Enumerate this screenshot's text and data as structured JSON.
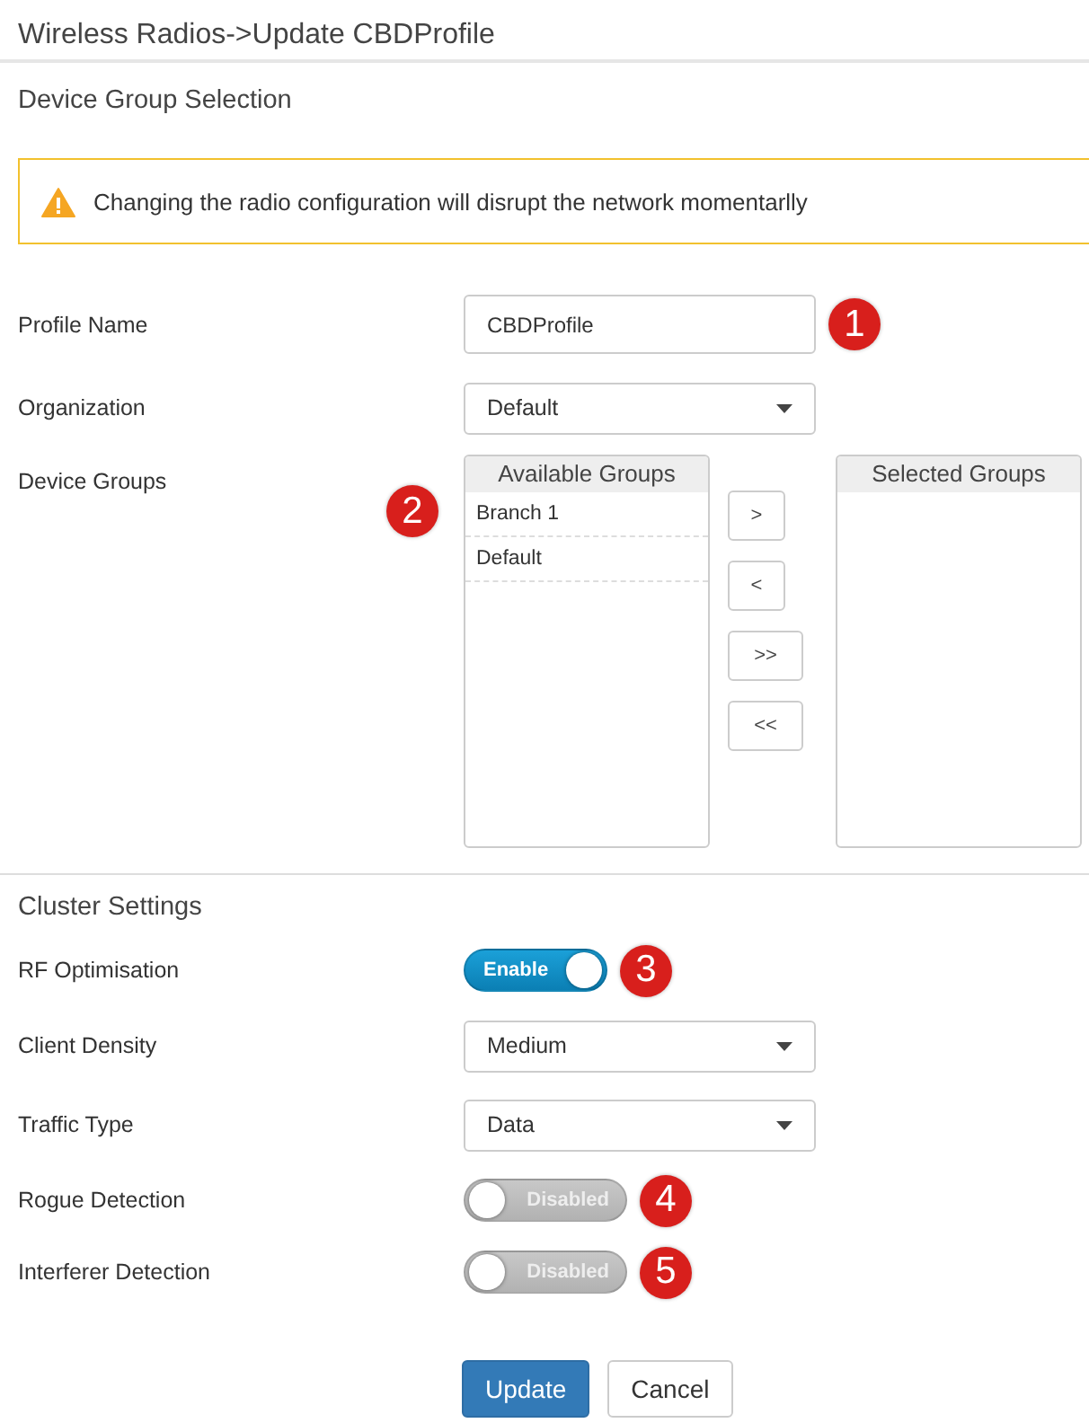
{
  "page_title": "Wireless Radios->Update CBDProfile",
  "sections": [
    {
      "title": "Device Group Selection",
      "warning": "Changing the radio configuration will disrupt the network momentarlly",
      "fields": [
        {
          "kind": "input",
          "label": "Profile Name",
          "value": "CBDProfile",
          "callout": "1"
        },
        {
          "kind": "select",
          "label": "Organization",
          "value": "Default"
        },
        {
          "kind": "duallist",
          "label": "Device Groups",
          "callout": "2",
          "available": {
            "title": "Available Groups",
            "items": [
              "Branch 1",
              "Default"
            ]
          },
          "selected": {
            "title": "Selected Groups"
          },
          "move_buttons": [
            ">",
            "<",
            ">>",
            "<<"
          ]
        }
      ]
    },
    {
      "title": "Cluster Settings",
      "fields": [
        {
          "kind": "toggle",
          "label": "RF Optimisation",
          "on": true,
          "text": "Enable",
          "callout": "3"
        },
        {
          "kind": "select",
          "label": "Client Density",
          "value": "Medium"
        },
        {
          "kind": "select",
          "label": "Traffic Type",
          "value": "Data"
        },
        {
          "kind": "toggle",
          "label": "Rogue Detection",
          "on": false,
          "text": "Disabled",
          "callout": "4"
        },
        {
          "kind": "toggle",
          "label": "Interferer Detection",
          "on": false,
          "text": "Disabled",
          "callout": "5"
        }
      ]
    }
  ],
  "buttons": [
    {
      "kind": "primary",
      "label": "Update"
    },
    {
      "kind": "secondary",
      "label": "Cancel"
    }
  ]
}
